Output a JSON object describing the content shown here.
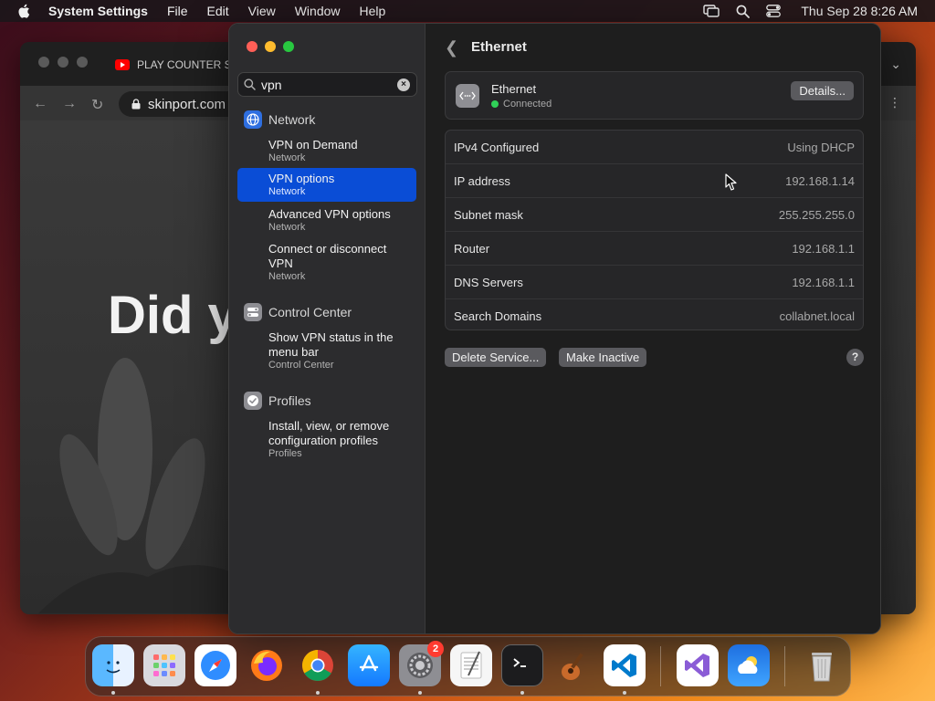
{
  "menubar": {
    "app_name": "System Settings",
    "menus": [
      "File",
      "Edit",
      "View",
      "Window",
      "Help"
    ],
    "clock": "Thu Sep 28  8:26 AM"
  },
  "browser": {
    "tab_title": "PLAY COUNTER S",
    "url": "skinport.com",
    "hero_text": "Did y"
  },
  "settings": {
    "search": {
      "value": "vpn"
    },
    "groups": [
      {
        "label": "Network",
        "icon": "globe-icon",
        "results": [
          {
            "title": "VPN on Demand",
            "sub": "Network",
            "selected": false
          },
          {
            "title": "VPN options",
            "sub": "Network",
            "selected": true
          },
          {
            "title": "Advanced VPN options",
            "sub": "Network",
            "selected": false
          },
          {
            "title": "Connect or disconnect VPN",
            "sub": "Network",
            "selected": false
          }
        ]
      },
      {
        "label": "Control Center",
        "icon": "toggle-icon",
        "results": [
          {
            "title": "Show VPN status in the menu bar",
            "sub": "Control Center",
            "selected": false
          }
        ]
      },
      {
        "label": "Profiles",
        "icon": "checkmark-seal-icon",
        "results": [
          {
            "title": "Install, view, or remove configuration profiles",
            "sub": "Profiles",
            "selected": false
          }
        ]
      }
    ],
    "pane": {
      "title": "Ethernet",
      "service": {
        "name": "Ethernet",
        "status": "Connected",
        "status_color": "#30d158",
        "details_label": "Details..."
      },
      "rows": [
        {
          "key": "IPv4 Configured",
          "value": "Using DHCP"
        },
        {
          "key": "IP address",
          "value": "192.168.1.14"
        },
        {
          "key": "Subnet mask",
          "value": "255.255.255.0"
        },
        {
          "key": "Router",
          "value": "192.168.1.1"
        },
        {
          "key": "DNS Servers",
          "value": "192.168.1.1"
        },
        {
          "key": "Search Domains",
          "value": "collabnet.local"
        }
      ],
      "delete_label": "Delete Service...",
      "inactive_label": "Make Inactive",
      "help_label": "?"
    }
  },
  "dock": {
    "apps": [
      "finder-icon",
      "launchpad-icon",
      "safari-icon",
      "firefox-icon",
      "chrome-icon",
      "app-store-icon",
      "system-settings-icon",
      "textedit-icon",
      "terminal-icon",
      "garageband-icon",
      "vscode-icon",
      "visual-studio-icon",
      "weather-icon",
      "trash-icon"
    ],
    "settings_badge": "2"
  },
  "colors": {
    "accent": "#0a4dd6",
    "connected": "#30d158"
  }
}
